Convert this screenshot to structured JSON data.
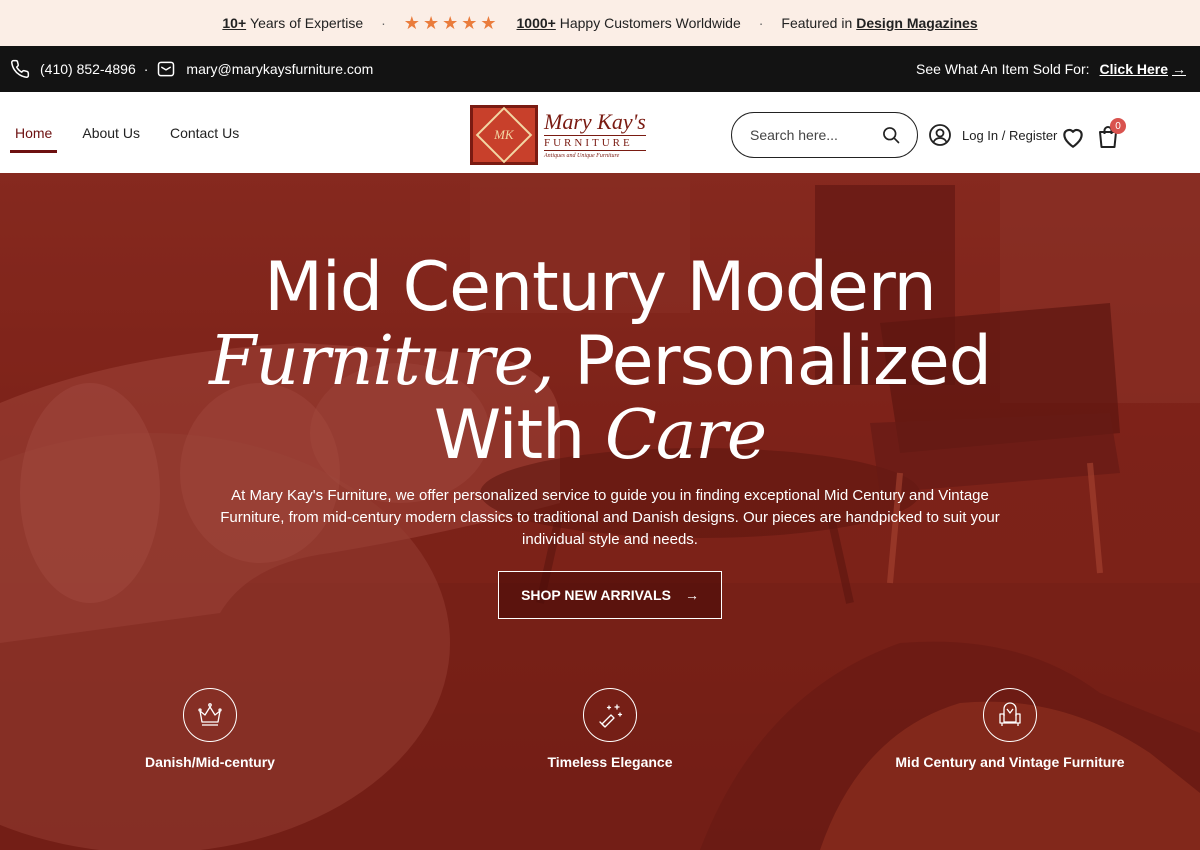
{
  "announcement": {
    "years_num": "10+",
    "years_text": "Years of Expertise",
    "customers_num": "1000+",
    "customers_text": "Happy Customers Worldwide",
    "featured_text": "Featured in",
    "featured_link": "Design Magazines",
    "rating_stars": 5
  },
  "contact": {
    "phone": "(410) 852-4896",
    "email": "mary@marykaysfurniture.com",
    "sold_text": "See What An Item Sold For:",
    "sold_link": "Click Here"
  },
  "nav": {
    "home": "Home",
    "about": "About Us",
    "contact": "Contact Us"
  },
  "logo": {
    "script": "Mary Kay's",
    "word": "FURNITURE",
    "tagline": "Antiques and Unique Furniture",
    "monogram": "MK"
  },
  "search": {
    "placeholder": "Search here..."
  },
  "account": {
    "login_label": "Log In / Register"
  },
  "cart": {
    "count": "0"
  },
  "hero": {
    "line1": "Mid Century Modern",
    "line2_serif": "Furniture,",
    "line2_rest": " Personalized",
    "line3_plain": "With ",
    "line3_serif": "Care",
    "description": "At Mary Kay's Furniture, we offer personalized service to guide you in finding exceptional Mid Century and Vintage Furniture, from mid-century modern classics to traditional and Danish designs. Our pieces are handpicked to suit your individual style and needs.",
    "cta_label": "SHOP NEW ARRIVALS"
  },
  "features": [
    {
      "label": "Danish/Mid-century",
      "icon": "crown-icon"
    },
    {
      "label": "Timeless Elegance",
      "icon": "sparkle-brush-icon"
    },
    {
      "label": "Mid Century and Vintage Furniture",
      "icon": "armchair-icon"
    }
  ],
  "colors": {
    "accent": "#6d1010",
    "topbar_bg": "#fbeee6",
    "contact_bg": "#131313",
    "star": "#ea7c3c",
    "hero_overlay": "#7d2219",
    "badge": "#d9534f"
  }
}
